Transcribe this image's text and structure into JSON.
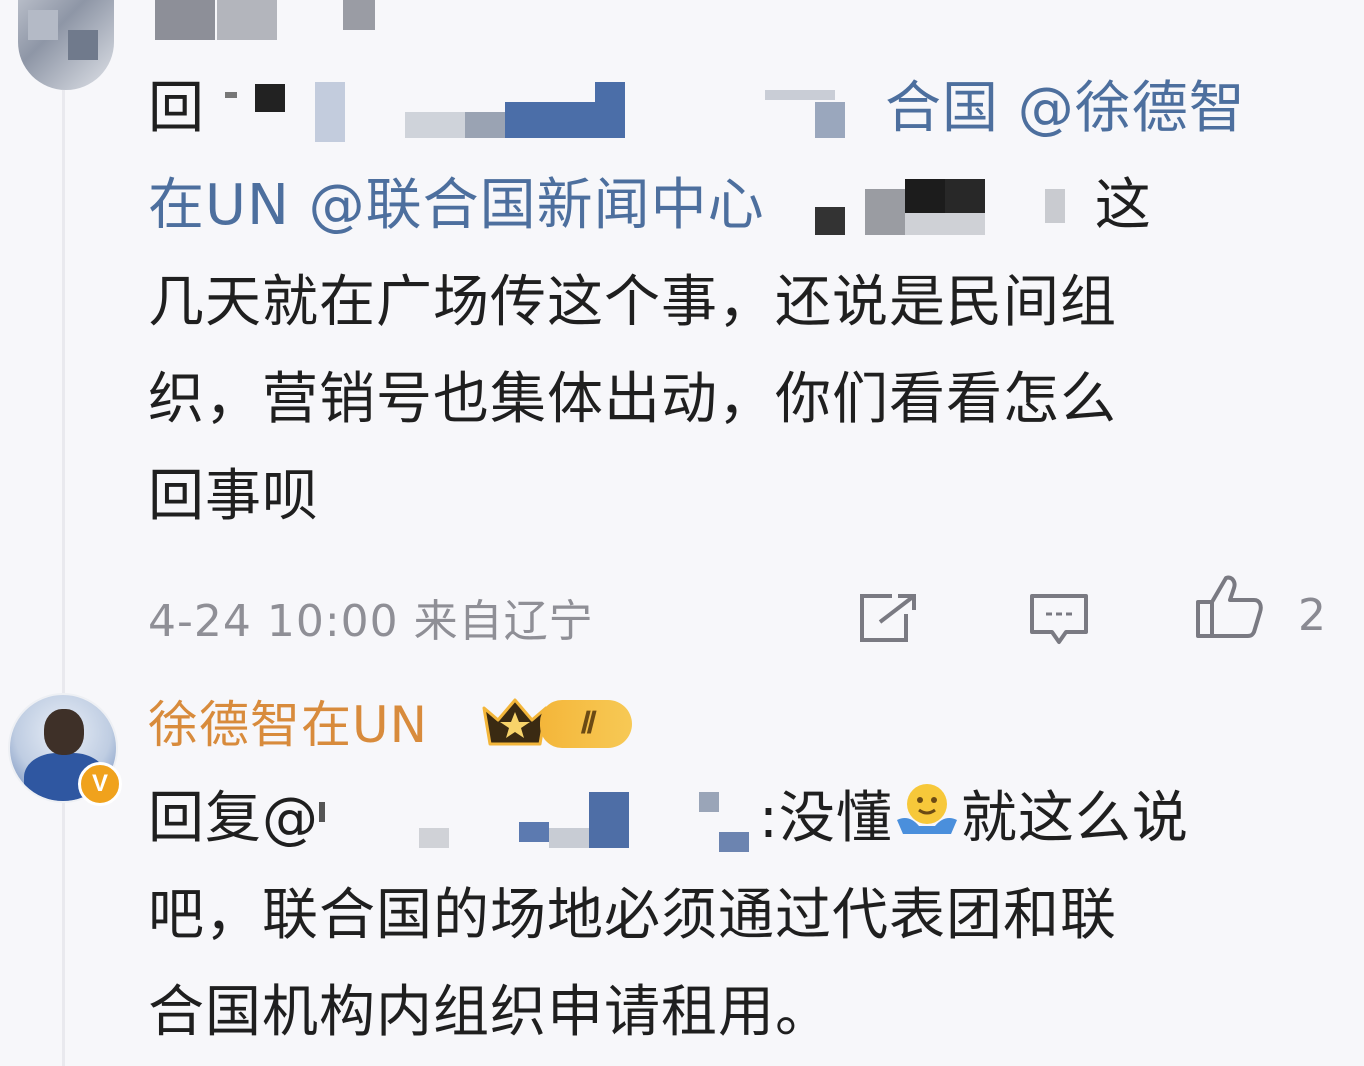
{
  "reply1": {
    "prefix": "回",
    "line1_tail": "合国 @徐德智",
    "line2_mentions": "在UN @联合国新闻中心",
    "line2_tail": "这",
    "line3": "几天就在广场传这个事，还说是民间组",
    "line4": "织，营销号也集体出动，你们看看怎么",
    "line5": "回事呗"
  },
  "meta": {
    "timestamp": "4-24 10:00 来自辽宁",
    "like_count": "2",
    "icons": [
      "share-icon",
      "comment-icon",
      "like-icon"
    ]
  },
  "reply2": {
    "username": "徐德智在UN",
    "level": "Ⅱ",
    "verified_badge": "V",
    "line1_prefix": "回复@",
    "line1_mid": ":没懂",
    "line1_tail": "就这么说",
    "line2": "吧，联合国的场地必须通过代表团和联",
    "line3": "合国机构内组织申请租用。"
  },
  "colors": {
    "mention_blue": "#4d6f9e",
    "username_orange": "#d88b3c",
    "badge_gold": "#f0a21c"
  }
}
